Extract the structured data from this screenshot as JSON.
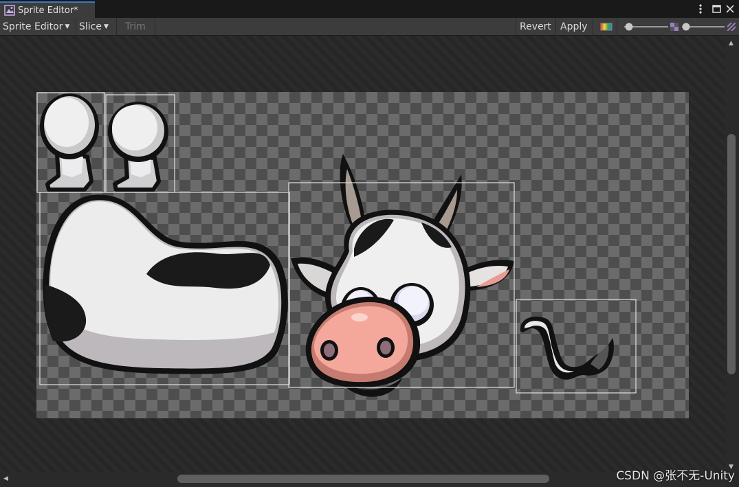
{
  "tab": {
    "title": "Sprite Editor*"
  },
  "toolbar": {
    "mode": "Sprite Editor",
    "slice": "Slice",
    "trim": "Trim",
    "revert": "Revert",
    "apply": "Apply"
  },
  "colors": {
    "tab_accent": "#3a79bb",
    "toolbar_bg": "#3c3c3c",
    "canvas_bg": "#2b2b2b",
    "checker_light": "#6b6b6b",
    "checker_dark": "#4e4e4e",
    "sprite_outline": "#e0e0e0"
  },
  "icons": [
    "sprite-editor-icon",
    "more-options-icon",
    "maximize-icon",
    "close-icon",
    "color-channel-icon",
    "alpha-icon",
    "mip-level-icon"
  ],
  "sprites": [
    "leg-front",
    "leg-back",
    "body",
    "head",
    "tail"
  ],
  "watermark": "CSDN @张不无-Unity"
}
